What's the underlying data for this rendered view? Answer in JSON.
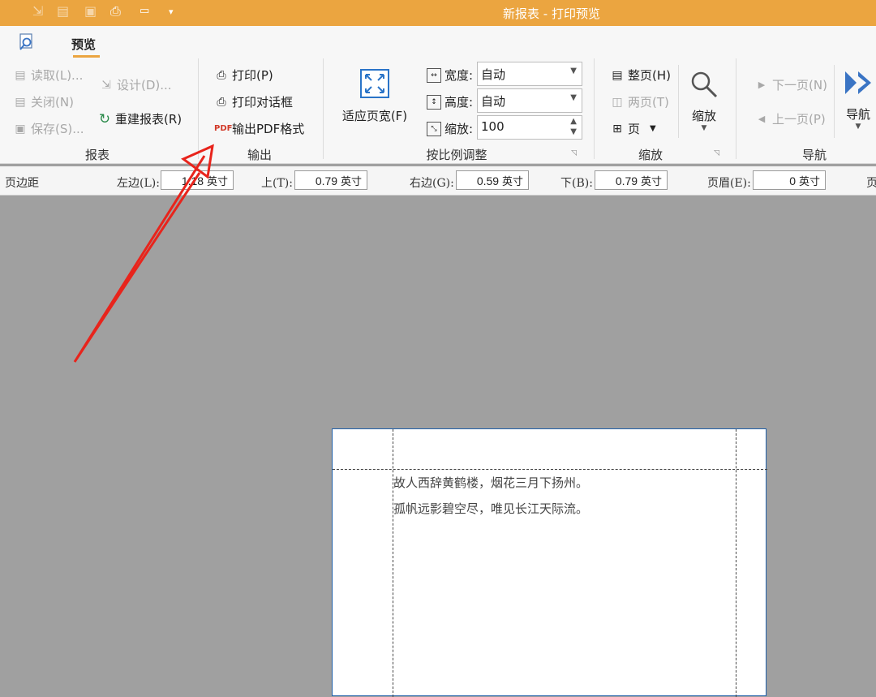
{
  "window": {
    "title": "新报表 - 打印预览"
  },
  "quick_access": [
    "export-icon",
    "new-icon",
    "save-icon",
    "print-icon",
    "pdf-icon",
    "dropdown-icon"
  ],
  "tabs": [
    {
      "label": "预览"
    }
  ],
  "ribbon": {
    "report_group": {
      "label": "报表",
      "read": "读取(L)...",
      "design": "设计(D)...",
      "close": "关闭(N)",
      "save": "保存(S)...",
      "rebuild": "重建报表(R)"
    },
    "output_group": {
      "label": "输出",
      "print": "打印(P)",
      "print_dialog": "打印对话框",
      "export_pdf": "输出PDF格式"
    },
    "scale_group": {
      "label": "按比例调整",
      "fit_width": "适应页宽(F)",
      "width_label": "宽度:",
      "width_value": "自动",
      "height_label": "高度:",
      "height_value": "自动",
      "zoom_label": "缩放:",
      "zoom_value": "100"
    },
    "zoom_group": {
      "label": "缩放",
      "whole_page": "整页(H)",
      "two_pages": "两页(T)",
      "pages": "页",
      "zoom": "缩放"
    },
    "nav_group": {
      "label": "导航",
      "next": "下一页(N)",
      "prev": "上一页(P)",
      "navigate": "导航"
    }
  },
  "margins": {
    "title": "页边距",
    "left_label": "左边(L):",
    "left_value": "1.18",
    "top_label": "上(T):",
    "top_value": "0.79",
    "right_label": "右边(G):",
    "right_value": "0.59",
    "bottom_label": "下(B):",
    "bottom_value": "0.79",
    "header_label": "页眉(E):",
    "header_value": "0",
    "unit": "英寸",
    "cut_label": "页"
  },
  "page_content": {
    "line1": "故人西辞黄鹤楼，烟花三月下扬州。",
    "line2": "孤帆远影碧空尽，唯见长江天际流。"
  },
  "colors": {
    "accent": "#eba540",
    "arrow": "#e8241c",
    "nav_blue": "#3a74c4"
  }
}
